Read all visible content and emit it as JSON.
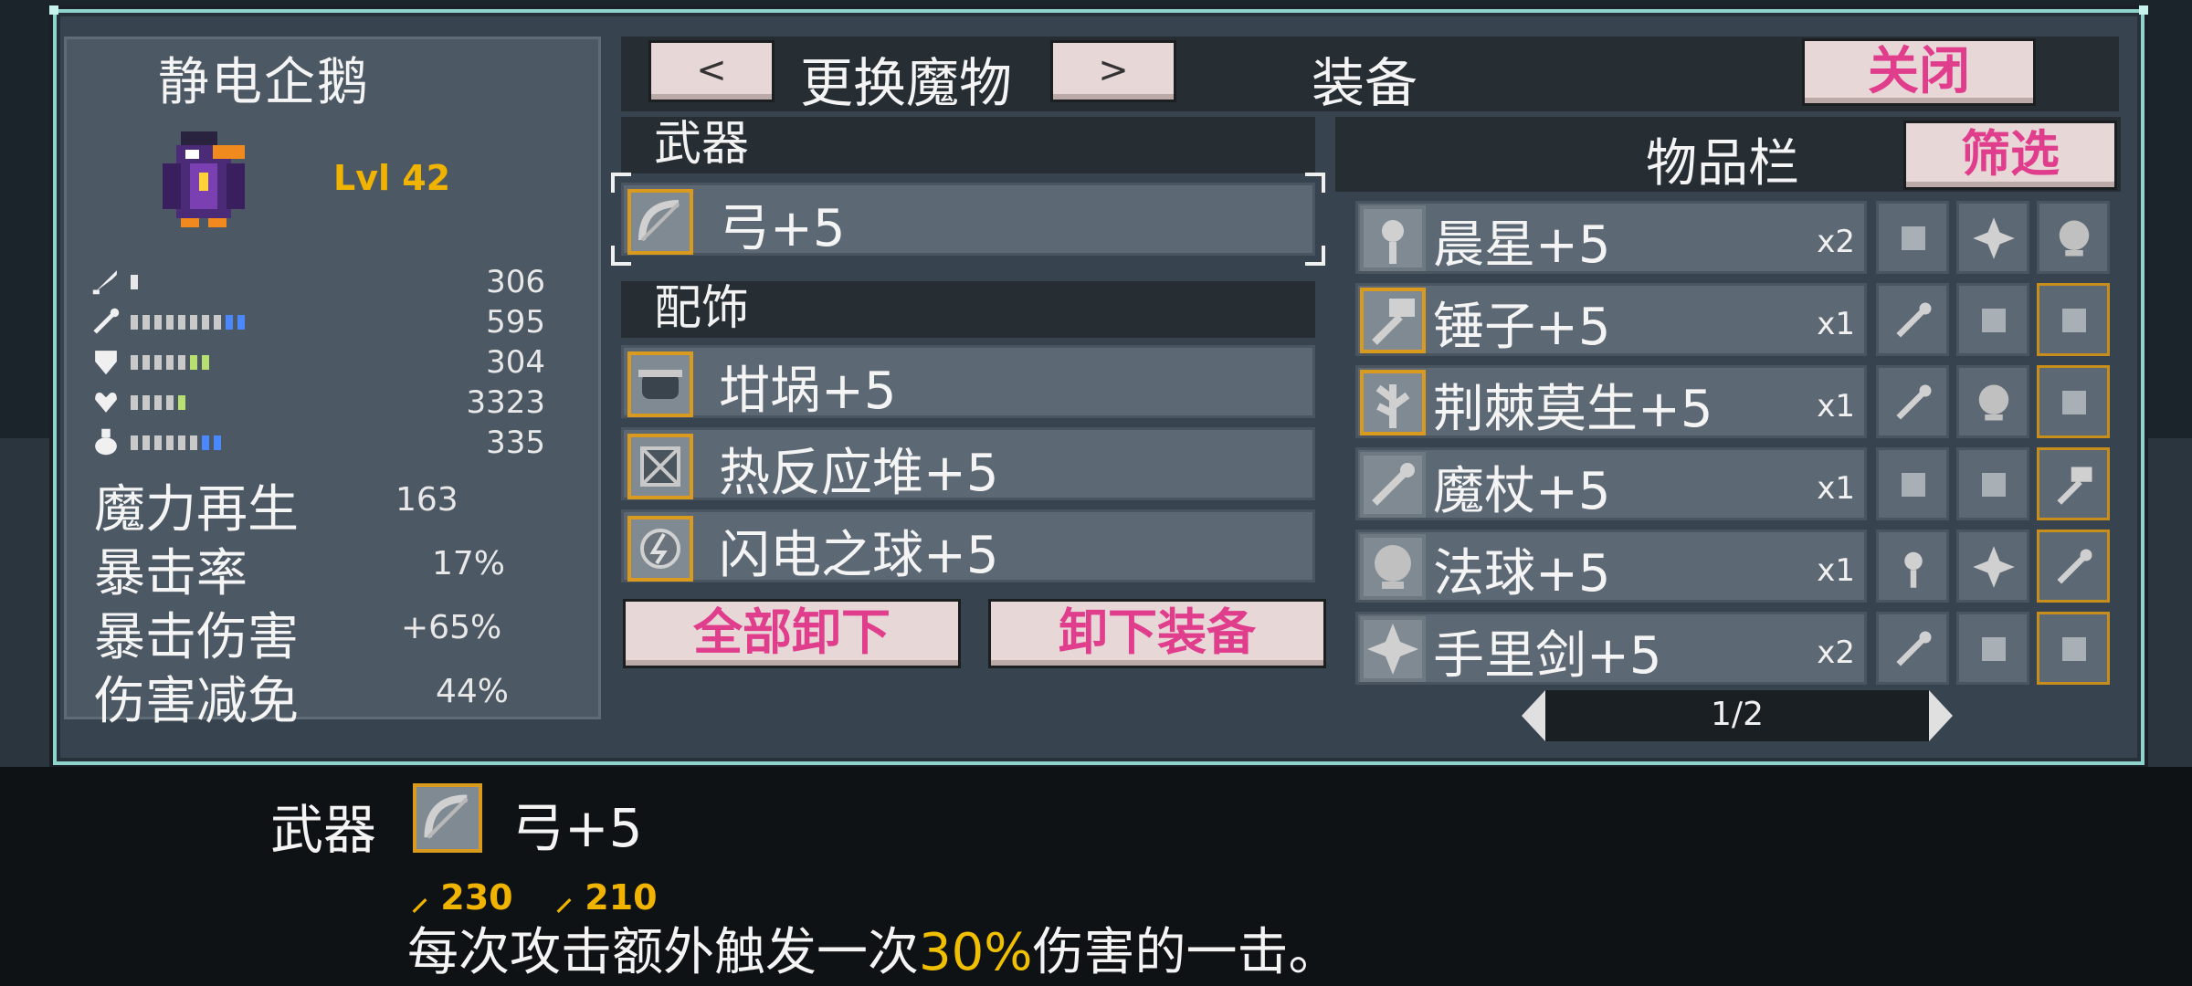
{
  "monster": {
    "name": "静电企鹅",
    "level": "Lvl 42"
  },
  "stats": [
    {
      "icon": "sword-icon",
      "value": "306",
      "bars": [
        [
          "#e8e8e8",
          1
        ]
      ]
    },
    {
      "icon": "wand-icon",
      "value": "595",
      "bars": [
        [
          "#c9c9c9",
          8
        ],
        [
          "#4a88ff",
          2
        ]
      ]
    },
    {
      "icon": "shield-icon",
      "value": "304",
      "bars": [
        [
          "#c9c9c9",
          5
        ],
        [
          "#b8e070",
          2
        ]
      ]
    },
    {
      "icon": "heart-icon",
      "value": "3323",
      "bars": [
        [
          "#c9c9c9",
          4
        ],
        [
          "#b8e070",
          1
        ]
      ]
    },
    {
      "icon": "potion-icon",
      "value": "335",
      "bars": [
        [
          "#c9c9c9",
          6
        ],
        [
          "#4a88ff",
          2
        ]
      ]
    }
  ],
  "text_stats": [
    {
      "label": "魔力再生",
      "value": "163"
    },
    {
      "label": "暴击率",
      "value": "17%"
    },
    {
      "label": "暴击伤害",
      "value": "+65%"
    },
    {
      "label": "伤害减免",
      "value": "44%"
    }
  ],
  "topbar": {
    "prev": "<",
    "title": "更换魔物",
    "next": ">",
    "section": "装备",
    "close": "关闭"
  },
  "equipment": {
    "weapon_header": "武器",
    "weapon": "弓+5",
    "accessory_header": "配饰",
    "accessories": [
      "坩埚+5",
      "热反应堆+5",
      "闪电之球+5"
    ],
    "unequip_all": "全部卸下",
    "unequip": "卸下装备"
  },
  "inventory": {
    "title": "物品栏",
    "filter": "筛选",
    "items": [
      {
        "name": "晨星+5",
        "qty": "x2",
        "icon": "morningstar-icon"
      },
      {
        "name": "锤子+5",
        "qty": "x1",
        "icon": "hammer-icon"
      },
      {
        "name": "荆棘莫生+5",
        "qty": "x1",
        "icon": "thorn-icon"
      },
      {
        "name": "魔杖+5",
        "qty": "x1",
        "icon": "wand-icon"
      },
      {
        "name": "法球+5",
        "qty": "x1",
        "icon": "orb-icon"
      },
      {
        "name": "手里剑+5",
        "qty": "x2",
        "icon": "shuriken-icon"
      }
    ],
    "page": "1/2"
  },
  "info": {
    "label": "武器",
    "name": "弓+5",
    "stat1": "230",
    "stat2": "210",
    "desc_before": "每次攻击额外触发一次",
    "desc_highlight": "30%",
    "desc_after": "伤害的一击。"
  },
  "colors": {
    "accent_pink": "#e03d8c",
    "gold": "#f0b400",
    "frame": "#8fd3cc"
  }
}
